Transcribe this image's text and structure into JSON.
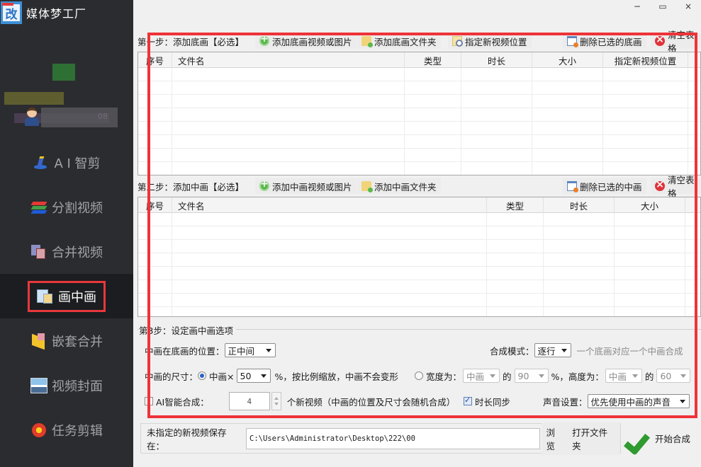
{
  "app": {
    "title": "媒体梦工厂",
    "logo_char": "改"
  },
  "window": {
    "minimize": "−",
    "maximize": "▭",
    "close": "×"
  },
  "user": {
    "blurred_suffix": "08"
  },
  "sidebar": {
    "items": [
      {
        "label": "A I 智剪",
        "icon": "magic-wand-icon",
        "active": false
      },
      {
        "label": "分割视频",
        "icon": "layers-icon",
        "active": false
      },
      {
        "label": "合并视频",
        "icon": "merge-icon",
        "active": false
      },
      {
        "label": "画中画",
        "icon": "picture-in-picture-icon",
        "active": true
      },
      {
        "label": "嵌套合并",
        "icon": "nest-folder-icon",
        "active": false
      },
      {
        "label": "视频封面",
        "icon": "landscape-icon",
        "active": false
      },
      {
        "label": "任务剪辑",
        "icon": "flower-icon",
        "active": false
      }
    ]
  },
  "step1": {
    "label": "第一步：添加底画【必选】",
    "buttons": {
      "add_media": "添加底画视频或图片",
      "add_folder": "添加底画文件夹",
      "set_location": "指定新视频位置",
      "delete_selected": "删除已选的底画",
      "clear_table": "清空表格"
    },
    "columns": [
      "序号",
      "文件名",
      "类型",
      "时长",
      "大小",
      "指定新视频位置"
    ],
    "rows": []
  },
  "step2": {
    "label": "第二步：添加中画【必选】",
    "buttons": {
      "add_media": "添加中画视频或图片",
      "add_folder": "添加中画文件夹",
      "delete_selected": "删除已选的中画",
      "clear_table": "清空表格"
    },
    "columns": [
      "序号",
      "文件名",
      "类型",
      "时长",
      "大小"
    ],
    "rows": []
  },
  "step3": {
    "label": "第3步：设定画中画选项",
    "position_label": "中画在底画的位置：",
    "position_value": "正中间",
    "mode_label": "合成模式：",
    "mode_value": "逐行",
    "mode_hint": "一个底画对应一个中画合成",
    "size_label": "中画的尺寸：",
    "size_scale_radio": "中画×",
    "size_scale_selected": true,
    "size_scale_value": "50",
    "size_scale_suffix": "%，按比例缩放，中画不会变形",
    "width_radio": "宽度为：",
    "width_ref": "中画",
    "of1": "的",
    "width_percent": "90",
    "height_label": "%，高度为：",
    "height_ref": "中画",
    "of2": "的",
    "height_percent": "60",
    "ai_label": "AI智能合成：",
    "ai_checked": false,
    "ai_count": "4",
    "ai_suffix": "个新视频（中画的位置及尺寸会随机合成）",
    "duration_sync_label": "时长同步",
    "duration_sync_checked": true,
    "audio_label": "声音设置：",
    "audio_value": "优先使用中画的声音"
  },
  "output": {
    "label": "未指定的新视频保存在：",
    "path": "C:\\Users\\Administrator\\Desktop\\222\\00",
    "browse": "浏览",
    "open_folder": "打开文件夹"
  },
  "start": {
    "label": "开始合成"
  },
  "colors": {
    "accent_red": "#ee3338",
    "sidebar_bg": "#2b2c30",
    "success_green": "#2f9a2f"
  }
}
